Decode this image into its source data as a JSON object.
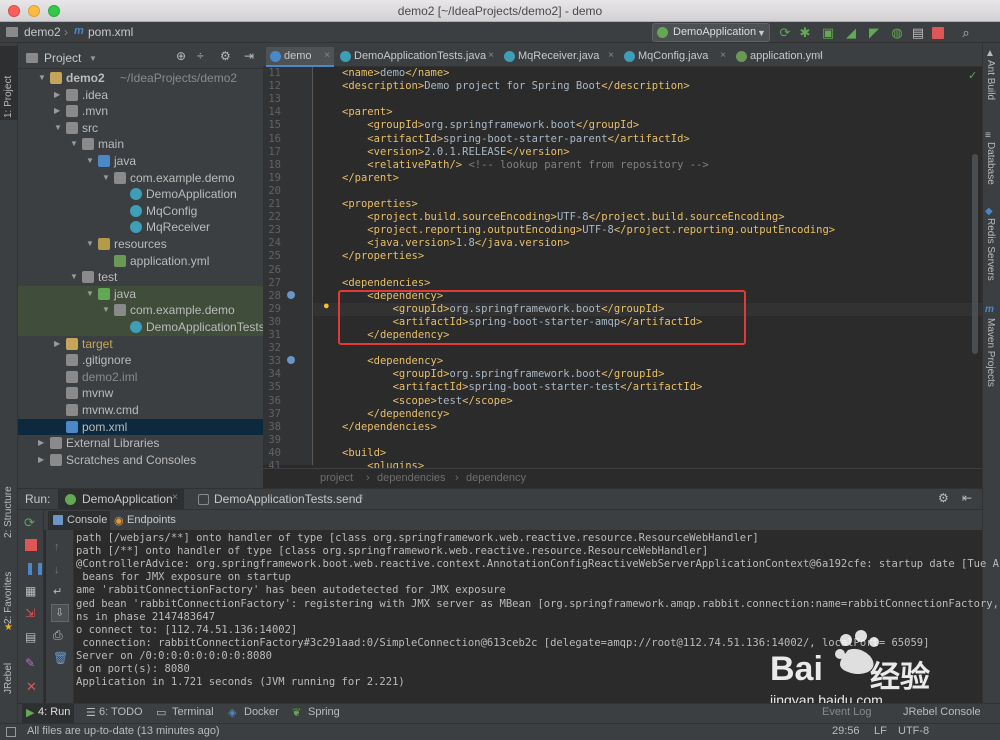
{
  "window": {
    "title": "demo2 [~/IdeaProjects/demo2] - demo"
  },
  "navbar": {
    "project": "demo2",
    "file": "pom.xml",
    "run_config": "DemoApplication"
  },
  "left_strip": {
    "project": "1: Project",
    "structure": "2: Structure",
    "favorites": "2: Favorites",
    "jrebel": "JRebel"
  },
  "right_strip": {
    "ant": "Ant Build",
    "database": "Database",
    "redis": "Redis Servers",
    "maven": "Maven Projects"
  },
  "project_panel": {
    "title": "Project",
    "tree": [
      {
        "label": "demo2",
        "extra": "~/IdeaProjects/demo2",
        "depth": 0,
        "arrow": "▼",
        "icon": "folder-icon",
        "color": "#c5a55a",
        "bold": true
      },
      {
        "label": ".idea",
        "depth": 1,
        "arrow": "▶",
        "icon": "folder-icon",
        "color": "#8a8a8a"
      },
      {
        "label": ".mvn",
        "depth": 1,
        "arrow": "▶",
        "icon": "folder-icon",
        "color": "#8a8a8a"
      },
      {
        "label": "src",
        "depth": 1,
        "arrow": "▼",
        "icon": "folder-icon",
        "color": "#8a8a8a"
      },
      {
        "label": "main",
        "depth": 2,
        "arrow": "▼",
        "icon": "folder-icon",
        "color": "#8a8a8a"
      },
      {
        "label": "java",
        "depth": 3,
        "arrow": "▼",
        "icon": "source-folder-icon",
        "color": "#4a88c7"
      },
      {
        "label": "com.example.demo",
        "depth": 4,
        "arrow": "▼",
        "icon": "package-icon",
        "color": "#8a8a8a"
      },
      {
        "label": "DemoApplication",
        "depth": 5,
        "arrow": "",
        "icon": "class-icon",
        "color": "#3d9eb5"
      },
      {
        "label": "MqConfig",
        "depth": 5,
        "arrow": "",
        "icon": "class-icon",
        "color": "#3d9eb5"
      },
      {
        "label": "MqReceiver",
        "depth": 5,
        "arrow": "",
        "icon": "class-icon",
        "color": "#3d9eb5"
      },
      {
        "label": "resources",
        "depth": 3,
        "arrow": "▼",
        "icon": "resources-folder-icon",
        "color": "#b59a4a"
      },
      {
        "label": "application.yml",
        "depth": 4,
        "arrow": "",
        "icon": "yml-icon",
        "color": "#6a9955"
      },
      {
        "label": "test",
        "depth": 2,
        "arrow": "▼",
        "icon": "folder-icon",
        "color": "#8a8a8a"
      },
      {
        "label": "java",
        "depth": 3,
        "arrow": "▼",
        "icon": "test-folder-icon",
        "color": "#62a855",
        "hl": true
      },
      {
        "label": "com.example.demo",
        "depth": 4,
        "arrow": "▼",
        "icon": "package-icon",
        "color": "#8a8a8a",
        "hl": true
      },
      {
        "label": "DemoApplicationTests",
        "depth": 5,
        "arrow": "",
        "icon": "class-icon",
        "color": "#3d9eb5",
        "hl": true
      },
      {
        "label": "target",
        "depth": 1,
        "arrow": "▶",
        "icon": "folder-icon",
        "color": "#c5a55a",
        "dim": true
      },
      {
        "label": ".gitignore",
        "depth": 1,
        "arrow": "",
        "icon": "file-icon",
        "color": "#8a8a8a"
      },
      {
        "label": "demo2.iml",
        "depth": 1,
        "arrow": "",
        "icon": "iml-icon",
        "color": "#8a8a8a",
        "dim": true
      },
      {
        "label": "mvnw",
        "depth": 1,
        "arrow": "",
        "icon": "file-icon",
        "color": "#8a8a8a"
      },
      {
        "label": "mvnw.cmd",
        "depth": 1,
        "arrow": "",
        "icon": "file-icon",
        "color": "#8a8a8a"
      },
      {
        "label": "pom.xml",
        "depth": 1,
        "arrow": "",
        "icon": "maven-icon",
        "color": "#4a88c7",
        "selected": true
      },
      {
        "label": "External Libraries",
        "depth": 0,
        "arrow": "▶",
        "icon": "library-icon",
        "color": "#8a8a8a"
      },
      {
        "label": "Scratches and Consoles",
        "depth": 0,
        "arrow": "▶",
        "icon": "scratch-icon",
        "color": "#8a8a8a"
      }
    ]
  },
  "editor_tabs": [
    {
      "label": "demo",
      "icon": "maven-icon",
      "color": "#4a88c7",
      "active": true
    },
    {
      "label": "DemoApplicationTests.java",
      "icon": "class-icon",
      "color": "#3d9eb5"
    },
    {
      "label": "MqReceiver.java",
      "icon": "class-icon",
      "color": "#3d9eb5"
    },
    {
      "label": "MqConfig.java",
      "icon": "class-icon",
      "color": "#3d9eb5"
    },
    {
      "label": "application.yml",
      "icon": "yml-icon",
      "color": "#6a9955"
    }
  ],
  "editor": {
    "lines": [
      {
        "n": "11",
        "html": "<span class='t'>&lt;name&gt;</span>demo<span class='t'>&lt;/name&gt;</span>"
      },
      {
        "n": "12",
        "html": "<span class='t'>&lt;description&gt;</span>Demo project for Spring Boot<span class='t'>&lt;/description&gt;</span>"
      },
      {
        "n": "13",
        "html": ""
      },
      {
        "n": "14",
        "html": "<span class='t'>&lt;parent&gt;</span>"
      },
      {
        "n": "15",
        "html": "    <span class='t'>&lt;groupId&gt;</span>org.springframework.boot<span class='t'>&lt;/groupId&gt;</span>"
      },
      {
        "n": "16",
        "html": "    <span class='t'>&lt;artifactId&gt;</span>spring-boot-starter-parent<span class='t'>&lt;/artifactId&gt;</span>"
      },
      {
        "n": "17",
        "html": "    <span class='t'>&lt;version&gt;</span>2.0.1.RELEASE<span class='t'>&lt;/version&gt;</span>"
      },
      {
        "n": "18",
        "html": "    <span class='t'>&lt;relativePath/&gt;</span> <span class='c'>&lt;!-- lookup parent from repository --&gt;</span>"
      },
      {
        "n": "19",
        "html": "<span class='t'>&lt;/parent&gt;</span>"
      },
      {
        "n": "20",
        "html": ""
      },
      {
        "n": "21",
        "html": "<span class='t'>&lt;properties&gt;</span>"
      },
      {
        "n": "22",
        "html": "    <span class='t'>&lt;project.build.sourceEncoding&gt;</span>UTF-8<span class='t'>&lt;/project.build.sourceEncoding&gt;</span>"
      },
      {
        "n": "23",
        "html": "    <span class='t'>&lt;project.reporting.outputEncoding&gt;</span>UTF-8<span class='t'>&lt;/project.reporting.outputEncoding&gt;</span>"
      },
      {
        "n": "24",
        "html": "    <span class='t'>&lt;java.version&gt;</span>1.8<span class='t'>&lt;/java.version&gt;</span>"
      },
      {
        "n": "25",
        "html": "<span class='t'>&lt;/properties&gt;</span>"
      },
      {
        "n": "26",
        "html": ""
      },
      {
        "n": "27",
        "html": "<span class='t'>&lt;dependencies&gt;</span>"
      },
      {
        "n": "28",
        "html": "    <span class='t'>&lt;dependency&gt;</span>"
      },
      {
        "n": "29",
        "html": "        <span class='t'>&lt;groupId&gt;</span>org.springframework.boot<span class='t'>&lt;/groupId&gt;</span>"
      },
      {
        "n": "30",
        "html": "        <span class='t'>&lt;artifactId&gt;</span>spring-boot-starter-amqp<span class='t'>&lt;/artifactId&gt;</span>"
      },
      {
        "n": "31",
        "html": "    <span class='t'>&lt;/dependency&gt;</span>"
      },
      {
        "n": "32",
        "html": ""
      },
      {
        "n": "33",
        "html": "    <span class='t'>&lt;dependency&gt;</span>"
      },
      {
        "n": "34",
        "html": "        <span class='t'>&lt;groupId&gt;</span>org.springframework.boot<span class='t'>&lt;/groupId&gt;</span>"
      },
      {
        "n": "35",
        "html": "        <span class='t'>&lt;artifactId&gt;</span>spring-boot-starter-test<span class='t'>&lt;/artifactId&gt;</span>"
      },
      {
        "n": "36",
        "html": "        <span class='t'>&lt;scope&gt;</span>test<span class='t'>&lt;/scope&gt;</span>"
      },
      {
        "n": "37",
        "html": "    <span class='t'>&lt;/dependency&gt;</span>"
      },
      {
        "n": "38",
        "html": "<span class='t'>&lt;/dependencies&gt;</span>"
      },
      {
        "n": "39",
        "html": ""
      },
      {
        "n": "40",
        "html": "<span class='t'>&lt;build&gt;</span>"
      },
      {
        "n": "41",
        "html": "    <span class='t'>&lt;plugins&gt;</span>"
      }
    ],
    "breadcrumb": [
      "project",
      "dependencies",
      "dependency"
    ]
  },
  "run_panel": {
    "label": "Run:",
    "tabs": [
      {
        "label": "DemoApplication",
        "icon": "spring-icon",
        "color": "#62a855"
      },
      {
        "label": "DemoApplicationTests.send",
        "icon": "test-icon",
        "color": "#8a8a8a"
      }
    ],
    "subtabs": {
      "console": "Console",
      "endpoints": "Endpoints"
    },
    "console_lines": [
      "path [/webjars/**] onto handler of type [class org.springframework.web.reactive.resource.ResourceWebHandler]",
      "path [/**] onto handler of type [class org.springframework.web.reactive.resource.ResourceWebHandler]",
      "@ControllerAdvice: org.springframework.boot.web.reactive.context.AnnotationConfigReactiveWebServerApplicationContext@6a192cfe: startup date [Tue A",
      " beans for JMX exposure on startup",
      "ame 'rabbitConnectionFactory' has been autodetected for JMX exposure",
      "ged bean 'rabbitConnectionFactory': registering with JMX server as MBean [org.springframework.amqp.rabbit.connection:name=rabbitConnectionFactory,",
      "ns in phase 2147483647",
      "o connect to: [112.74.51.136:14002]",
      " connection: rabbitConnectionFactory#3c291aad:0/SimpleConnection@613ceb2c [delegate=amqp://root@112.74.51.136:14002/, localPort= 65059]",
      "Server on /0:0:0:0:0:0:0:0:8080",
      "d on port(s): 8080",
      "Application in 1.721 seconds (JVM running for 2.221)"
    ]
  },
  "toolwindows": {
    "run": "4: Run",
    "todo": "6: TODO",
    "terminal": "Terminal",
    "docker": "Docker",
    "spring": "Spring",
    "event_log": "Event Log",
    "jrebel_console": "JRebel Console"
  },
  "status": {
    "message": "All files are up-to-date (13 minutes ago)",
    "position": "29:56",
    "line_sep": "LF",
    "encoding": "UTF-8"
  },
  "watermark": {
    "brand": "Bai",
    "brand2": "经验",
    "url": "jingyan.baidu.com"
  }
}
